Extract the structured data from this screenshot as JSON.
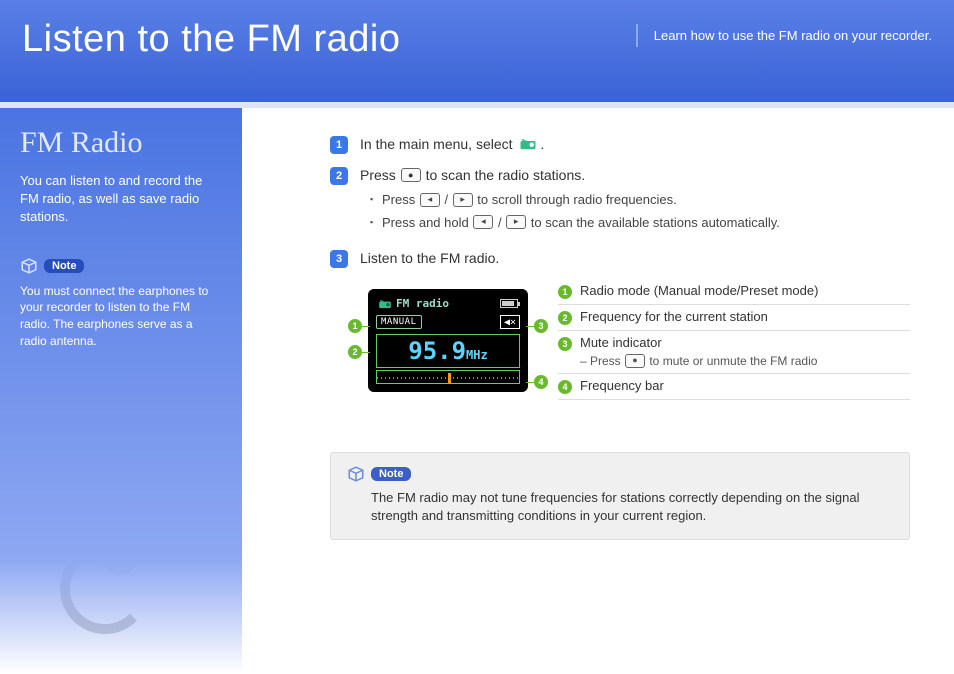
{
  "header": {
    "title": "Listen to the FM radio",
    "subtitle": "Learn how to use the FM radio on your recorder."
  },
  "sidebar": {
    "title": "FM Radio",
    "desc": "You can listen to and record the FM radio, as well as save radio stations.",
    "note_label": "Note",
    "note_body": "You must connect the earphones to your recorder to listen to the FM radio. The earphones serve as a radio antenna."
  },
  "steps": [
    {
      "num": "1",
      "text_a": "In the main menu, select ",
      "text_b": "."
    },
    {
      "num": "2",
      "text_a": "Press ",
      "text_b": " to scan the radio stations.",
      "subs": [
        {
          "pre": "Press ",
          "mid": " / ",
          "post": " to scroll through radio frequencies."
        },
        {
          "pre": "Press and hold ",
          "mid": " / ",
          "post": " to scan the available stations automatically."
        }
      ]
    },
    {
      "num": "3",
      "text_a": "Listen to the FM radio.",
      "text_b": ""
    }
  ],
  "device": {
    "title": "FM radio",
    "mode": "MANUAL",
    "freq": "95.9",
    "unit": "MHz",
    "mute_glyph": "◀×"
  },
  "legend": [
    {
      "n": "1",
      "t": "Radio mode (Manual mode/Preset mode)"
    },
    {
      "n": "2",
      "t": "Frequency for the current station"
    },
    {
      "n": "3",
      "t": "Mute indicator",
      "sub_pre": "– Press ",
      "sub_post": " to mute or unmute the FM radio"
    },
    {
      "n": "4",
      "t": "Frequency bar"
    }
  ],
  "note": {
    "label": "Note",
    "body": "The FM radio may not tune frequencies for stations correctly depending on the signal strength and transmitting conditions in your current region."
  }
}
